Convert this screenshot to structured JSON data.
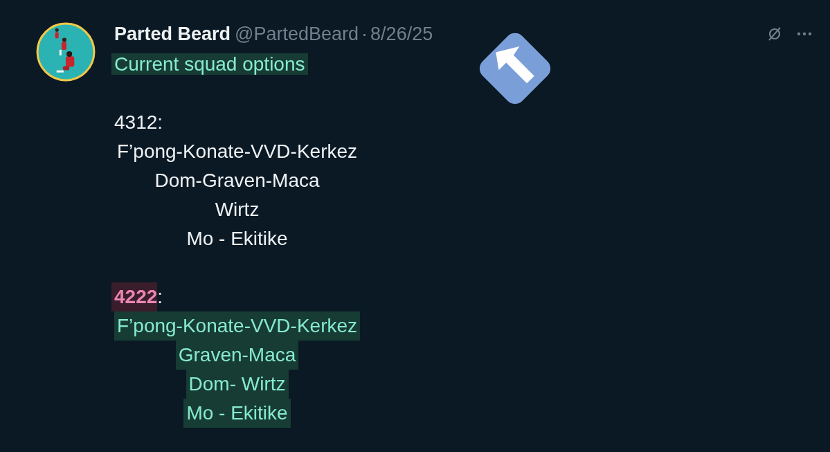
{
  "tweet": {
    "author": "Parted Beard",
    "handle": "@PartedBeard",
    "separator": "·",
    "date": "8/26/25",
    "intro": {
      "text": "Current squad options",
      "highlighted": true,
      "color": "#173c33"
    },
    "blocks": [
      {
        "heading": [
          {
            "text": "4312",
            "highlighted": false
          },
          {
            "text": ":",
            "highlighted": false
          }
        ],
        "lines": [
          {
            "text": "F’pong-Konate-VVD-Kerkez",
            "highlighted": false
          },
          {
            "text": "Dom-Graven-Maca",
            "highlighted": false
          },
          {
            "text": "Wirtz",
            "highlighted": false
          },
          {
            "text": "Mo - Ekitike",
            "highlighted": false
          }
        ]
      },
      {
        "heading": [
          {
            "text": "4222",
            "highlighted": true,
            "color": "#3a1d2a"
          },
          {
            "text": ":",
            "highlighted": false
          }
        ],
        "lines": [
          {
            "text": "F’pong-Konate-VVD-Kerkez",
            "highlighted": true,
            "color": "#173c33"
          },
          {
            "text": "Graven-Maca",
            "highlighted": true,
            "color": "#173c33"
          },
          {
            "text": "Dom- Wirtz",
            "highlighted": true,
            "color": "#173c33"
          },
          {
            "text": "Mo - Ekitike",
            "highlighted": true,
            "color": "#173c33"
          }
        ]
      }
    ]
  }
}
